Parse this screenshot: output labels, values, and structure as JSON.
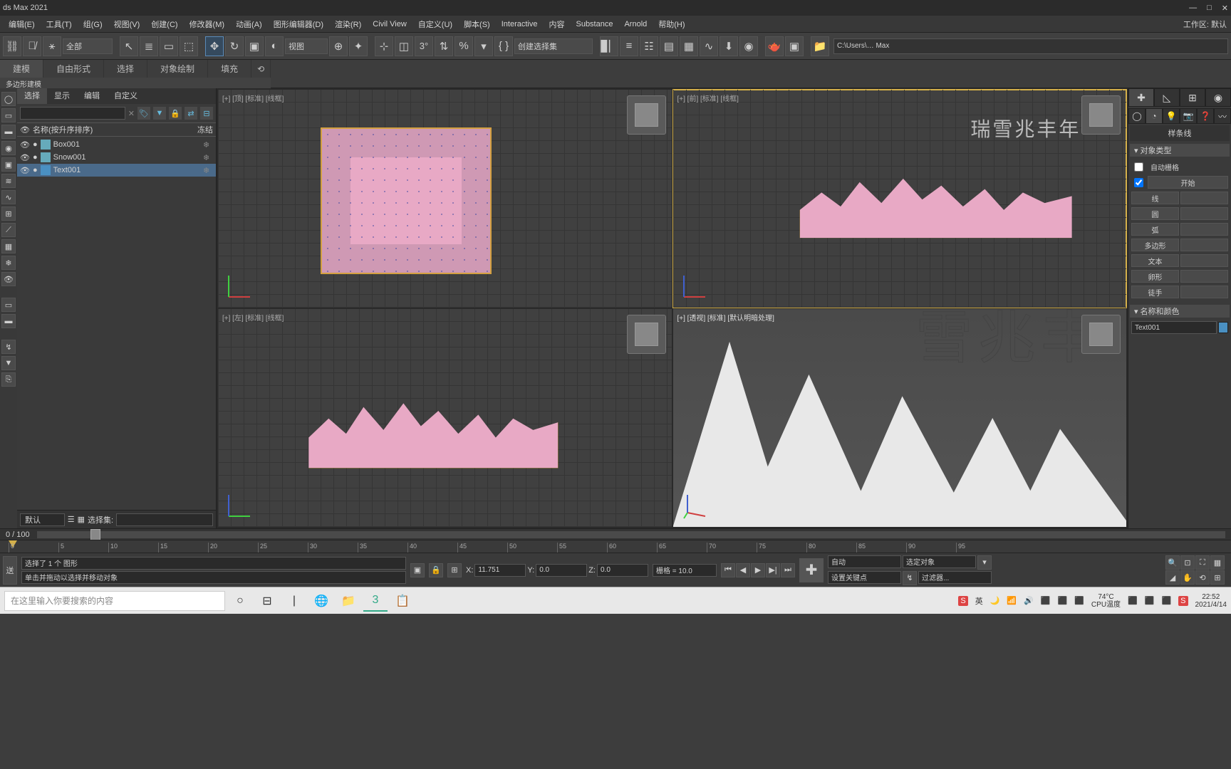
{
  "app": {
    "title": "ds Max 2021"
  },
  "menubar": {
    "items": [
      "编辑(E)",
      "工具(T)",
      "组(G)",
      "视图(V)",
      "创建(C)",
      "修改器(M)",
      "动画(A)",
      "图形编辑器(D)",
      "渲染(R)",
      "Civil View",
      "自定义(U)",
      "脚本(S)",
      "Interactive",
      "内容",
      "Substance",
      "Arnold",
      "帮助(H)"
    ],
    "workspace_label": "工作区:",
    "workspace_value": "默认"
  },
  "toolbar": {
    "scope_dropdown": "全部",
    "view_dropdown": "视图",
    "selection_set_dropdown": "创建选择集",
    "path": "C:\\Users\\… Max"
  },
  "ribbon": {
    "tabs": [
      "建模",
      "自由形式",
      "选择",
      "对象绘制",
      "填充"
    ],
    "subtab": "多边形建模"
  },
  "scene_explorer": {
    "tabs": [
      "选择",
      "显示",
      "编辑",
      "自定义"
    ],
    "header_name": "名称(按升序排序)",
    "header_freeze": "冻结",
    "items": [
      {
        "name": "Box001",
        "selected": false
      },
      {
        "name": "Snow001",
        "selected": false
      },
      {
        "name": "Text001",
        "selected": true
      }
    ],
    "layer_dropdown": "默认",
    "selection_set_label": "选择集:"
  },
  "viewports": {
    "top": {
      "label": "[+] [顶] [标准] [线框]"
    },
    "front": {
      "label": "[+] [前] [标准] [线框]",
      "text3d": "瑞雪兆丰年"
    },
    "left": {
      "label": "[+] [左] [标准] [线框]"
    },
    "persp": {
      "label": "[+] [透视] [标准] [默认明暗处理]",
      "text3d": "雪兆丰"
    }
  },
  "command_panel": {
    "category": "样条线",
    "rollout_objtype": "对象类型",
    "autogrid": "自动栅格",
    "start_shape": "开始",
    "buttons_row1": [
      "线",
      ""
    ],
    "buttons_row2": [
      "圆",
      ""
    ],
    "buttons_row3": [
      "弧",
      ""
    ],
    "buttons_row4": [
      "多边形",
      ""
    ],
    "buttons_row5": [
      "文本",
      ""
    ],
    "buttons_row6": [
      "卵形",
      ""
    ],
    "buttons_row7": [
      "徒手",
      ""
    ],
    "rollout_name": "名称和颜色",
    "obj_name": "Text001"
  },
  "timeline": {
    "frame_display": "0  /  100",
    "ticks": [
      0,
      5,
      10,
      15,
      20,
      25,
      30,
      35,
      40,
      45,
      50,
      55,
      60,
      65,
      70,
      75,
      80,
      85,
      90,
      95
    ]
  },
  "statusbar": {
    "prompt1": "选择了 1 个 图形",
    "prompt2": "单击并拖动以选择并移动对象",
    "x_label": "X:",
    "x_val": "11.751",
    "y_label": "Y:",
    "y_val": "0.0",
    "z_label": "Z:",
    "z_val": "0.0",
    "grid_label": "栅格 = 10.0",
    "auto_btn": "自动",
    "select_obj": "选定对象",
    "set_key": "设置关键点",
    "key_filter": "过滤器..."
  },
  "taskbar": {
    "search_placeholder": "在这里输入你要搜索的内容",
    "ime": "英",
    "temp": "74°C",
    "temp_label": "CPU温度",
    "time": "22:52",
    "date": "2021/4/14"
  }
}
